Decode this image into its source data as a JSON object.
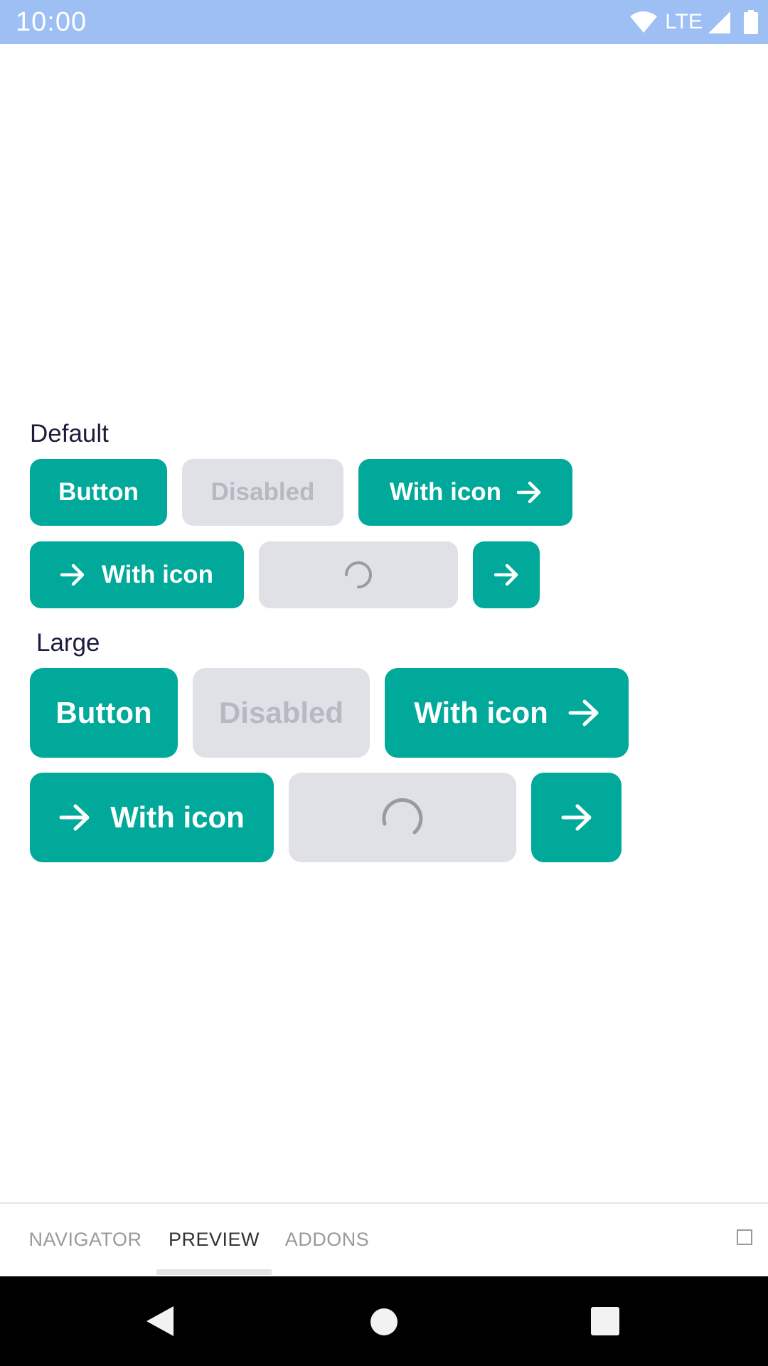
{
  "status_bar": {
    "time": "10:00",
    "network": "LTE",
    "icons": [
      "wifi-icon",
      "signal-icon",
      "battery-icon"
    ],
    "background": "#9dbff3"
  },
  "sections": {
    "default": {
      "label": "Default",
      "button": "Button",
      "disabled": "Disabled",
      "with_icon_right": "With icon",
      "with_icon_left": "With icon"
    },
    "large": {
      "label": "Large",
      "button": "Button",
      "disabled": "Disabled",
      "with_icon_right": "With icon",
      "with_icon_left": "With icon"
    }
  },
  "colors": {
    "primary": "#00a99a",
    "disabled_bg": "#e0e0e7",
    "disabled_text": "#b8b8c2",
    "label_text": "#1c1c3c"
  },
  "tabs": [
    {
      "label": "NAVIGATOR",
      "active": false
    },
    {
      "label": "PREVIEW",
      "active": true
    },
    {
      "label": "ADDONS",
      "active": false
    }
  ],
  "nav_bar": {
    "buttons": [
      "back-icon",
      "home-icon",
      "recents-icon"
    ]
  }
}
